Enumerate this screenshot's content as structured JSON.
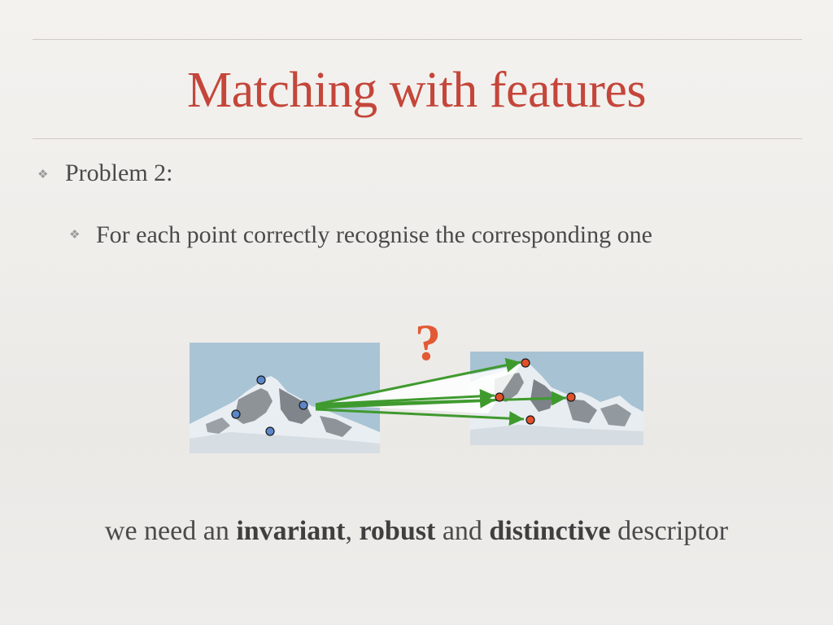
{
  "slide": {
    "title": "Matching with features",
    "bullet_level1": "Problem 2:",
    "bullet_level2": "For each point correctly recognise the corresponding one",
    "question_mark": "?",
    "bottom": {
      "prefix": "we need an ",
      "term1": "invariant",
      "sep1": ", ",
      "term2": "robust",
      "sep2": " and ",
      "term3": "distinctive",
      "suffix": " descriptor"
    }
  },
  "colors": {
    "title": "#c4463a",
    "question": "#e25a33",
    "left_points": "#5b86c8",
    "right_points": "#e2502a",
    "arrows": "#3f9a2e"
  },
  "icons": {
    "bullet": "fleuron-bullet-icon"
  },
  "images": {
    "left": "mountain-photo",
    "right": "mountain-photo-transformed"
  }
}
